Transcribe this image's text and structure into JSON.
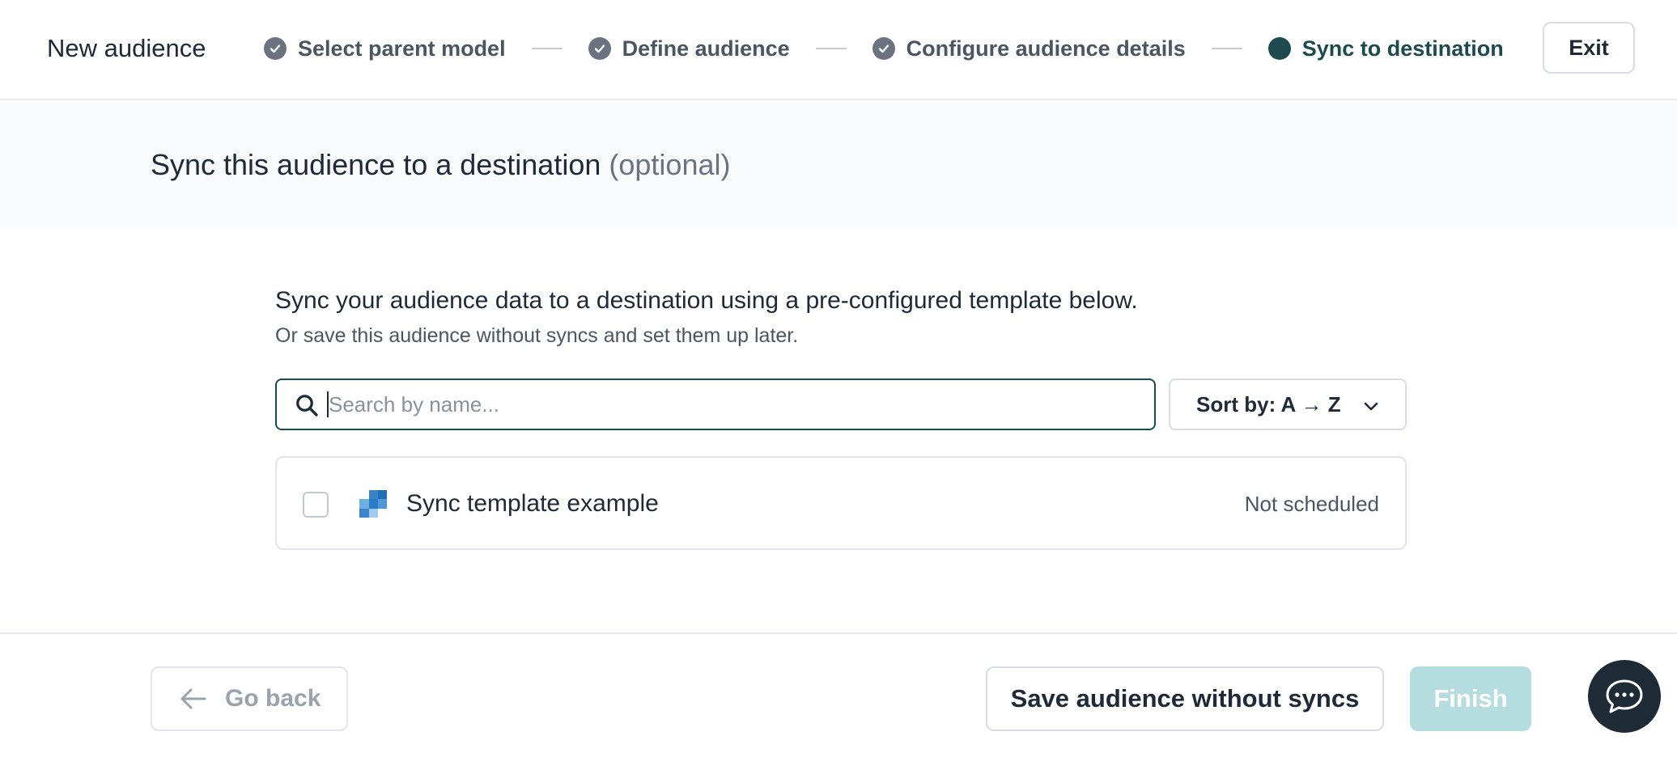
{
  "header": {
    "title": "New audience",
    "steps": [
      {
        "label": "Select parent model",
        "state": "complete"
      },
      {
        "label": "Define audience",
        "state": "complete"
      },
      {
        "label": "Configure audience details",
        "state": "complete"
      },
      {
        "label": "Sync to destination",
        "state": "current"
      }
    ],
    "exit_label": "Exit"
  },
  "banner": {
    "title": "Sync this audience to a destination",
    "optional": "(optional)"
  },
  "main": {
    "heading": "Sync your audience data to a destination using a pre-configured template below.",
    "subheading": "Or save this audience without syncs and set them up later.",
    "search": {
      "placeholder": "Search by name...",
      "value": ""
    },
    "sort": {
      "label": "Sort by: A → Z"
    },
    "templates": [
      {
        "name": "Sync template example",
        "status": "Not scheduled",
        "checked": false
      }
    ]
  },
  "footer": {
    "go_back_label": "Go back",
    "save_label": "Save audience without syncs",
    "finish_label": "Finish"
  },
  "colors": {
    "accent": "#1d4a4f",
    "finish_disabled": "#b5dcdf",
    "banner_bg": "#f8fafc",
    "chat_bg": "#1f2a37"
  },
  "icons": {
    "step_complete": "check-circle-icon",
    "step_current": "dot-icon",
    "search": "search-icon",
    "sort": "chevron-down-icon",
    "template": "template-logo-icon",
    "back": "arrow-left-icon",
    "chat": "chat-bubble-icon"
  }
}
